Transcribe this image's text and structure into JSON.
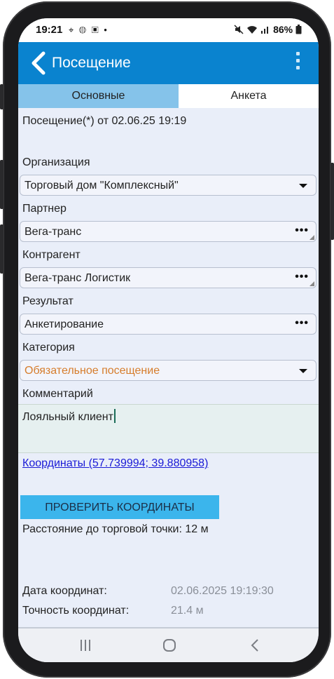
{
  "status": {
    "time": "19:21",
    "left_icons": "⌖ ◍ ▣ •",
    "battery": "86%"
  },
  "appbar": {
    "title": "Посещение"
  },
  "tabs": [
    {
      "label": "Основные",
      "active": true
    },
    {
      "label": "Анкета",
      "active": false
    }
  ],
  "visit": {
    "header": "Посещение(*) от 02.06.25 19:19"
  },
  "form": {
    "organization_label": "Организация",
    "organization_value": "Торговый дом \"Комплексный\"",
    "partner_label": "Партнер",
    "partner_value": "Вега-транс",
    "contractor_label": "Контрагент",
    "contractor_value": "Вега-транс Логистик",
    "result_label": "Результат",
    "result_value": "Анкетирование",
    "category_label": "Категория",
    "category_value": "Обязательное посещение",
    "comment_label": "Комментарий",
    "comment_value": "Лояльный клиент"
  },
  "coords": {
    "link": "Координаты (57.739994; 39.880958)",
    "check_button": "ПРОВЕРИТЬ КООРДИНАТЫ",
    "distance": "Расстояние до торговой точки: 12  м",
    "date_label": "Дата координат:",
    "date_value": "02.06.2025 19:19:30",
    "accuracy_label": "Точность координат:",
    "accuracy_value": "21.4  м"
  },
  "colors": {
    "appbar": "#0a83cf",
    "tab_active": "#85c3ea",
    "button": "#3bb5ec",
    "category_text": "#d67d2c",
    "link": "#1a1ad6"
  }
}
